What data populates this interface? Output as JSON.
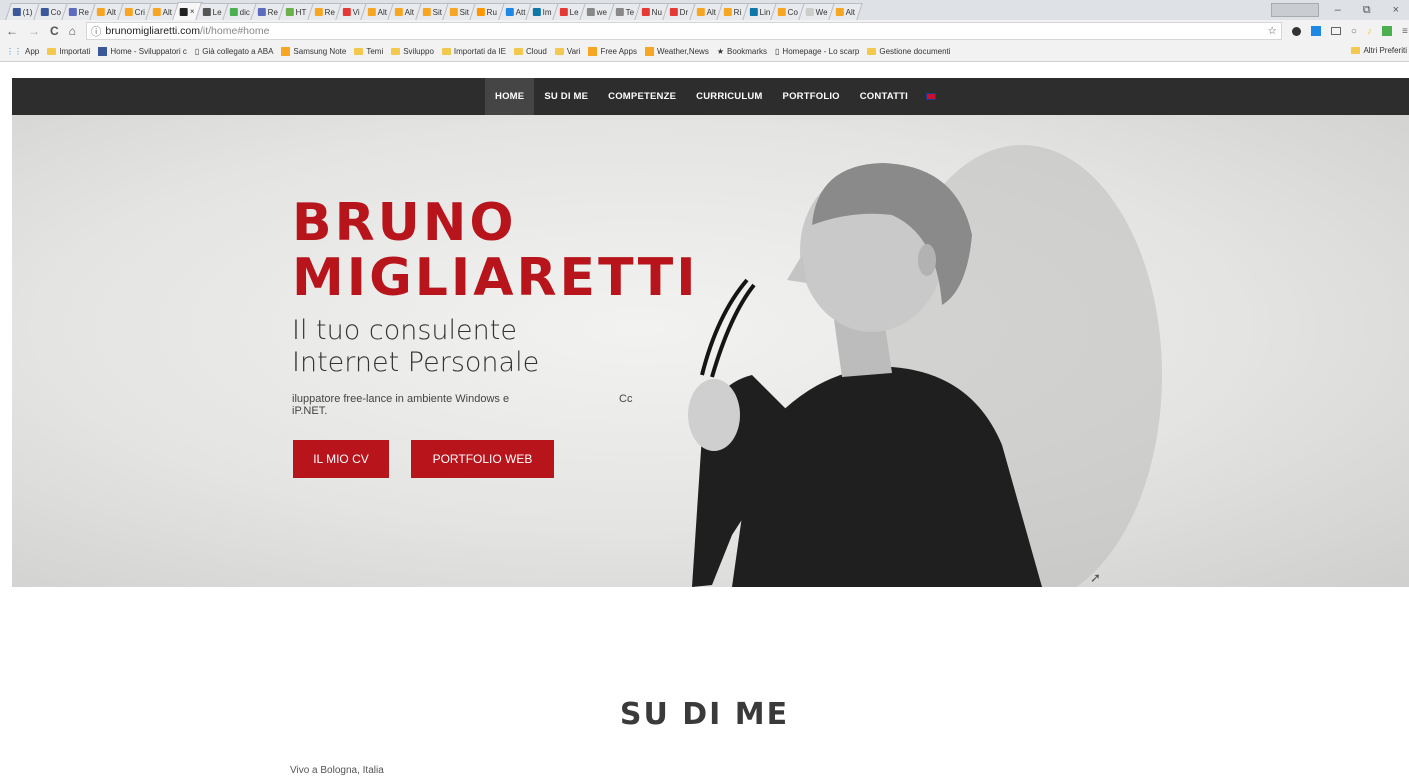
{
  "browser": {
    "tabs": [
      {
        "label": "(1)",
        "color": "#3b5998",
        "active": false
      },
      {
        "label": "Co",
        "color": "#3b5998",
        "active": false
      },
      {
        "label": "Re",
        "color": "#5c6bc0",
        "active": false
      },
      {
        "label": "Alt",
        "color": "#f6a623",
        "active": false
      },
      {
        "label": "Cri",
        "color": "#f6a623",
        "active": false
      },
      {
        "label": "Alt",
        "color": "#f6a623",
        "active": false
      },
      {
        "label": "×",
        "color": "#222222",
        "active": true
      },
      {
        "label": "Le",
        "color": "#555555",
        "active": false
      },
      {
        "label": "dic",
        "color": "#4caf50",
        "active": false
      },
      {
        "label": "Re",
        "color": "#5c6bc0",
        "active": false
      },
      {
        "label": "HT",
        "color": "#6ab04c",
        "active": false
      },
      {
        "label": "Re",
        "color": "#f6a623",
        "active": false
      },
      {
        "label": "Vi",
        "color": "#e53935",
        "active": false
      },
      {
        "label": "Alt",
        "color": "#f6a623",
        "active": false
      },
      {
        "label": "Alt",
        "color": "#f6a623",
        "active": false
      },
      {
        "label": "Sit",
        "color": "#f6a623",
        "active": false
      },
      {
        "label": "Sit",
        "color": "#f6a623",
        "active": false
      },
      {
        "label": "Ru",
        "color": "#ff9800",
        "active": false
      },
      {
        "label": "Att",
        "color": "#1e88e5",
        "active": false
      },
      {
        "label": "Im",
        "color": "#0e76a8",
        "active": false
      },
      {
        "label": "Le",
        "color": "#e53935",
        "active": false
      },
      {
        "label": "we",
        "color": "#888888",
        "active": false
      },
      {
        "label": "Te",
        "color": "#888888",
        "active": false
      },
      {
        "label": "Nu",
        "color": "#e53935",
        "active": false
      },
      {
        "label": "Dr",
        "color": "#e53935",
        "active": false
      },
      {
        "label": "Alt",
        "color": "#f6a623",
        "active": false
      },
      {
        "label": "Ri",
        "color": "#f6a623",
        "active": false
      },
      {
        "label": "Lin",
        "color": "#0e76a8",
        "active": false
      },
      {
        "label": "Co",
        "color": "#f6a623",
        "active": false
      },
      {
        "label": "We",
        "color": "#cccccc",
        "active": false
      },
      {
        "label": "Alt",
        "color": "#f6a623",
        "active": false
      }
    ],
    "window_controls": {
      "minimize": "–",
      "maximize": "⧉",
      "close": "×"
    },
    "nav_buttons": {
      "back": "←",
      "forward": "→",
      "reload": "C",
      "home": "⌂"
    },
    "url_host": "brunomigliaretti.com",
    "url_path": "/it/home#home",
    "info_icon": "ⓘ",
    "toolbar_icons": [
      "star-icon",
      "extension-icon",
      "extension-icon",
      "extension-icon",
      "extension-icon",
      "extension-icon",
      "extension-icon"
    ],
    "bookmarks": [
      {
        "label": "App",
        "kind": "apps"
      },
      {
        "label": "Importati",
        "kind": "folder"
      },
      {
        "label": "Home - Sviluppatori c",
        "kind": "facebook"
      },
      {
        "label": "Già collegato a ABA",
        "kind": "page"
      },
      {
        "label": "Samsung Note",
        "kind": "app"
      },
      {
        "label": "Temi",
        "kind": "folder"
      },
      {
        "label": "Sviluppo",
        "kind": "folder"
      },
      {
        "label": "Importati da IE",
        "kind": "folder"
      },
      {
        "label": "Cloud",
        "kind": "folder"
      },
      {
        "label": "Vari",
        "kind": "folder"
      },
      {
        "label": "Free Apps",
        "kind": "app"
      },
      {
        "label": "Weather,News",
        "kind": "app"
      },
      {
        "label": "Bookmarks",
        "kind": "star"
      },
      {
        "label": "Homepage - Lo scarp",
        "kind": "page"
      },
      {
        "label": "Gestione documenti",
        "kind": "folder"
      }
    ],
    "other_bookmarks": "Altri Preferiti"
  },
  "site": {
    "nav": [
      {
        "label": "HOME",
        "active": true
      },
      {
        "label": "SU DI ME",
        "active": false
      },
      {
        "label": "COMPETENZE",
        "active": false
      },
      {
        "label": "CURRICULUM",
        "active": false
      },
      {
        "label": "PORTFOLIO",
        "active": false
      },
      {
        "label": "CONTATTI",
        "active": false
      }
    ],
    "hero": {
      "name_line1": "BRUNO",
      "name_line2": "MIGLIARETTI",
      "tagline_line1": "Il tuo consulente",
      "tagline_line2": "Internet Personale",
      "desc_line1": "iluppatore free-lance in ambiente Windows e",
      "desc_line2": "iP.NET.",
      "desc_fragment": "Cc",
      "btn_cv": "IL MIO CV",
      "btn_portfolio": "PORTFOLIO WEB",
      "accent": "#b8141b"
    },
    "about_title": "SU DI ME",
    "location": "Vivo a Bologna, Italia"
  }
}
